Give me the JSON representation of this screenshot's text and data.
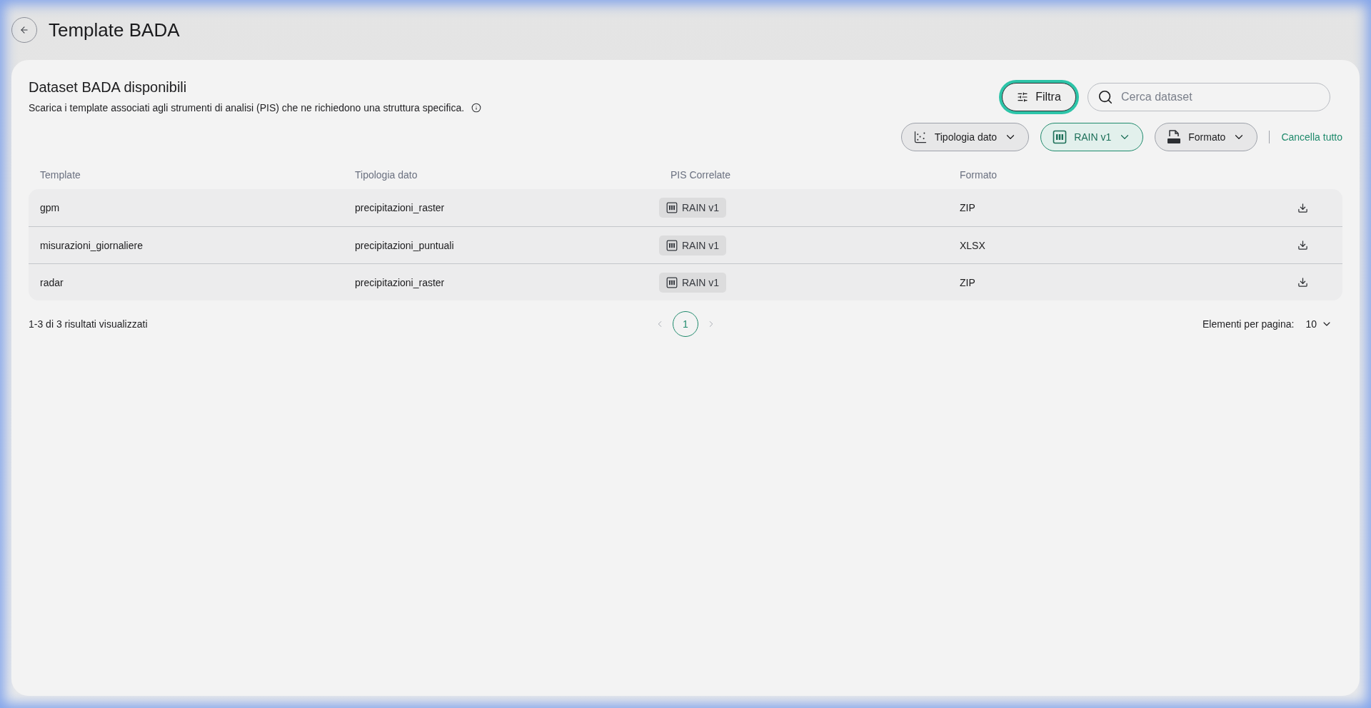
{
  "header": {
    "title": "Template BADA"
  },
  "panel": {
    "title": "Dataset BADA disponibili",
    "description": "Scarica i template associati agli strumenti di analisi (PIS) che ne richiedono una struttura specifica."
  },
  "toolbar": {
    "filter_button": {
      "label": "Filtra",
      "focused": true
    },
    "search": {
      "placeholder": "Cerca dataset"
    }
  },
  "filters": [
    {
      "kind": "chart",
      "label": "Tipologia dato",
      "selected": false
    },
    {
      "kind": "pis",
      "label": "RAIN v1",
      "selected": true
    },
    {
      "kind": "doc",
      "label": "Formato",
      "selected": false
    }
  ],
  "clear_all": "Cancella tutto",
  "table": {
    "columns": [
      "Template",
      "Tipologia dato",
      "PIS Correlate",
      "Formato"
    ],
    "rows": [
      {
        "template": "gpm",
        "type": "precipitazioni_raster",
        "pis": "RAIN v1",
        "format": "ZIP"
      },
      {
        "template": "misurazioni_giornaliere",
        "type": "precipitazioni_puntuali",
        "pis": "RAIN v1",
        "format": "XLSX"
      },
      {
        "template": "radar",
        "type": "precipitazioni_raster",
        "pis": "RAIN v1",
        "format": "ZIP"
      }
    ]
  },
  "pagination": {
    "summary": "1-3 di 3 risultati visualizzati",
    "pages": [
      {
        "label": "1",
        "selected": true
      }
    ],
    "per_page_label": "Elementi per pagina:",
    "per_page": "10"
  }
}
